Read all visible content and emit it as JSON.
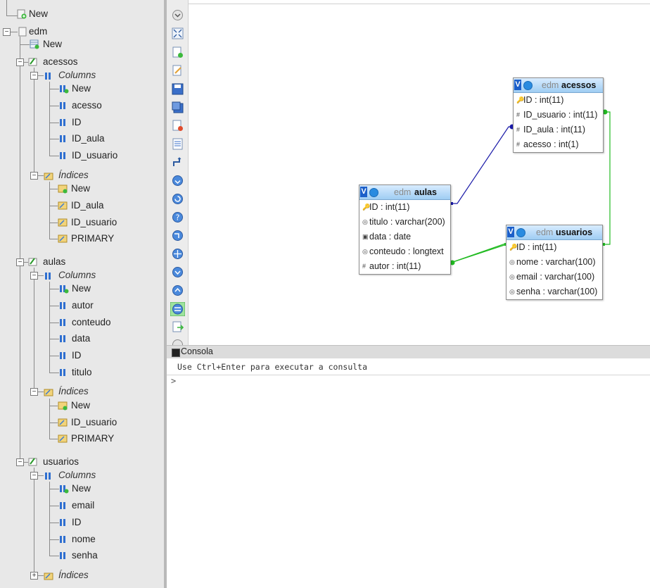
{
  "tree": {
    "root_new": "New",
    "db": {
      "name": "edm",
      "new": "New",
      "tables": [
        {
          "name": "acessos",
          "columns_label": "Columns",
          "columns": [
            "New",
            "acesso",
            "ID",
            "ID_aula",
            "ID_usuario"
          ],
          "indices_label": "Índices",
          "indices": [
            "New",
            "ID_aula",
            "ID_usuario",
            "PRIMARY"
          ]
        },
        {
          "name": "aulas",
          "columns_label": "Columns",
          "columns": [
            "New",
            "autor",
            "conteudo",
            "data",
            "ID",
            "titulo"
          ],
          "indices_label": "Índices",
          "indices": [
            "New",
            "ID_usuario",
            "PRIMARY"
          ]
        },
        {
          "name": "usuarios",
          "columns_label": "Columns",
          "columns": [
            "New",
            "email",
            "ID",
            "nome",
            "senha"
          ],
          "indices_label": "Índices"
        }
      ]
    }
  },
  "diagram": {
    "tables": [
      {
        "db": "edm",
        "name": "acessos",
        "columns": [
          {
            "text": "ID : int(11)",
            "key": "pk"
          },
          {
            "text": "ID_usuario : int(11)",
            "key": "fk"
          },
          {
            "text": "ID_aula : int(11)",
            "key": "fk"
          },
          {
            "text": "acesso : int(1)",
            "key": "fk"
          }
        ]
      },
      {
        "db": "edm",
        "name": "aulas",
        "columns": [
          {
            "text": "ID : int(11)",
            "key": "pk"
          },
          {
            "text": "titulo : varchar(200)",
            "key": "col"
          },
          {
            "text": "data : date",
            "key": "date"
          },
          {
            "text": "conteudo : longtext",
            "key": "col"
          },
          {
            "text": "autor : int(11)",
            "key": "fk"
          }
        ]
      },
      {
        "db": "edm",
        "name": "usuarios",
        "columns": [
          {
            "text": "ID : int(11)",
            "key": "pk"
          },
          {
            "text": "nome : varchar(100)",
            "key": "col"
          },
          {
            "text": "email : varchar(100)",
            "key": "col"
          },
          {
            "text": "senha : varchar(100)",
            "key": "col"
          }
        ]
      }
    ],
    "relation_colors": [
      "#1a1aa8",
      "#22bb22"
    ]
  },
  "console": {
    "title": "Consola",
    "hint": "Use Ctrl+Enter para executar a consulta",
    "prompt": ">"
  }
}
